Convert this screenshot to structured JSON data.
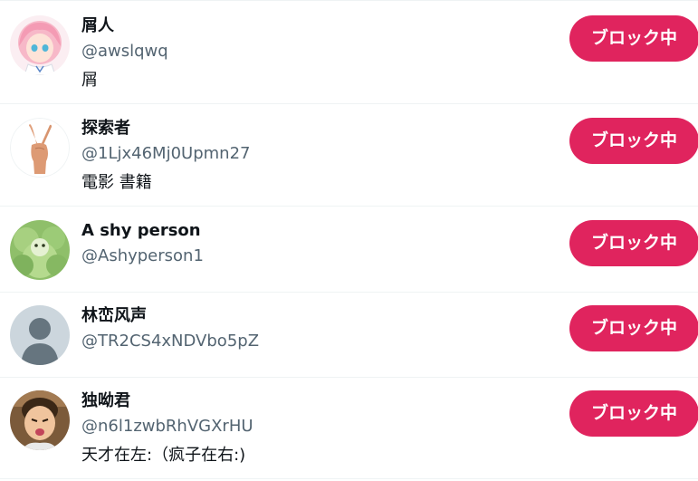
{
  "accent_color": "#e0245e",
  "button_label": "ブロック中",
  "users": [
    {
      "name": "屑人",
      "handle": "@awslqwq",
      "bio": "屑",
      "avatar_icon": "anime-girl-avatar"
    },
    {
      "name": "探索者",
      "handle": "@1Ljx46Mj0Upmn27",
      "bio": "電影 書籍",
      "avatar_icon": "peace-sign-hand-avatar"
    },
    {
      "name": "A shy person",
      "handle": "@Ashyperson1",
      "bio": "",
      "avatar_icon": "green-creature-avatar"
    },
    {
      "name": "林峦风声",
      "handle": "@TR2CS4xNDVbo5pZ",
      "bio": "",
      "avatar_icon": "default-person-avatar"
    },
    {
      "name": "独呦君",
      "handle": "@n6l1zwbRhVGXrHU",
      "bio": "天才在左:（疯子在右:)",
      "avatar_icon": "child-photo-avatar"
    }
  ]
}
